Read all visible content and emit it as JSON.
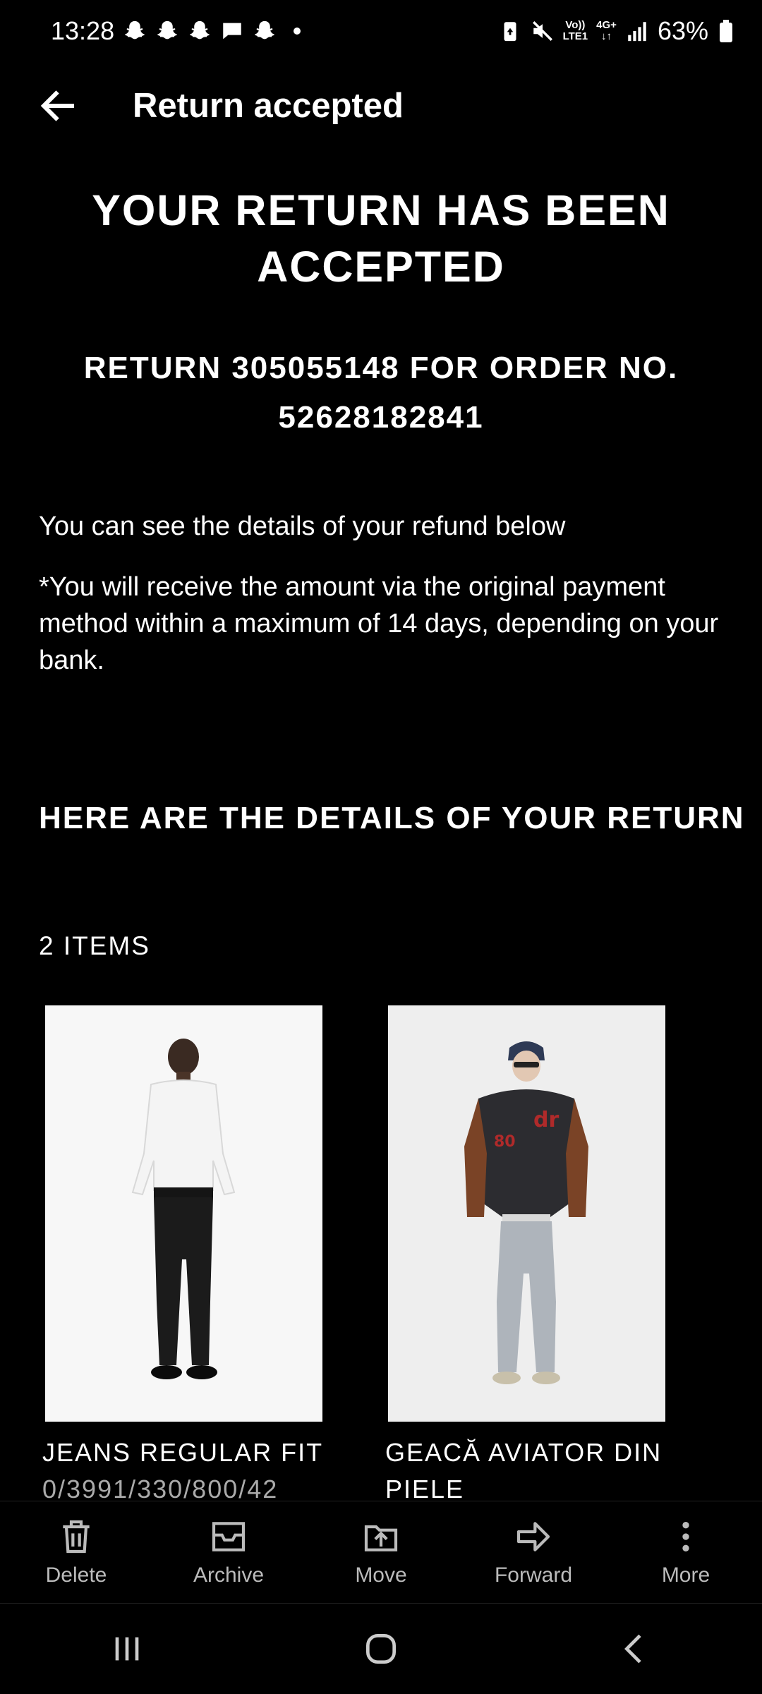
{
  "status_bar": {
    "time": "13:28",
    "network_top": "Vo))",
    "network_bottom": "LTE1",
    "network_gen": "4G+",
    "battery": "63%"
  },
  "app_bar": {
    "title": "Return accepted"
  },
  "content": {
    "headline": "YOUR RETURN HAS BEEN ACCEPTED",
    "subheadline": "RETURN 305055148 FOR ORDER NO. 52628182841",
    "refund_details_text": "You can see the details of your refund below",
    "refund_note": "*You will receive the amount via the original payment method within a maximum of 14 days, depending on your bank.",
    "section_title": "HERE ARE THE DETAILS OF YOUR RETURN",
    "items_count": "2 ITEMS",
    "items": [
      {
        "name": "JEANS REGULAR FIT",
        "sub": "0/3991/330/800/42"
      },
      {
        "name": "GEACĂ AVIATOR DIN",
        "sub": "PIELE"
      }
    ]
  },
  "actions": [
    {
      "label": "Delete",
      "icon": "trash-icon"
    },
    {
      "label": "Archive",
      "icon": "archive-icon"
    },
    {
      "label": "Move",
      "icon": "move-icon"
    },
    {
      "label": "Forward",
      "icon": "forward-icon"
    },
    {
      "label": "More",
      "icon": "more-vertical-icon"
    }
  ]
}
